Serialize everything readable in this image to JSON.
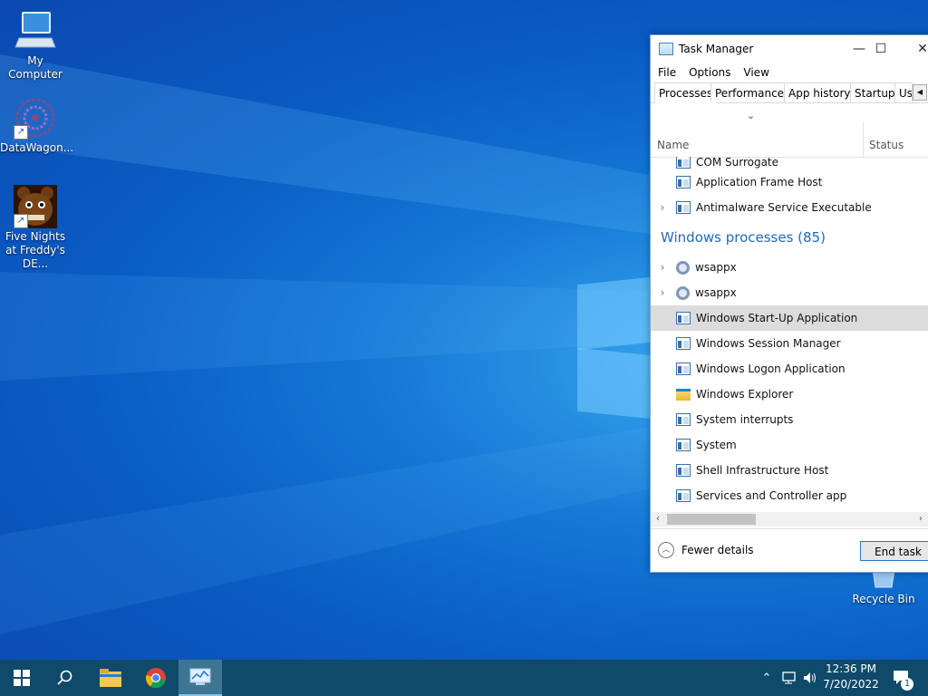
{
  "desktop": {
    "icons": [
      {
        "label": "My Computer",
        "icon": "computer-icon"
      },
      {
        "label": "DataWagon...",
        "icon": "datawagon-icon"
      },
      {
        "label": "Five Nights at Freddy's DE...",
        "icon": "freddy-icon"
      },
      {
        "label": "Recycle Bin",
        "icon": "recycle-bin-icon"
      }
    ]
  },
  "task_manager": {
    "title": "Task Manager",
    "title_buttons": {
      "minimize": "—",
      "maximize": "☐",
      "close": "✕"
    },
    "menu": [
      "File",
      "Options",
      "View"
    ],
    "tabs": [
      {
        "label": "Processes",
        "active": true
      },
      {
        "label": "Performance"
      },
      {
        "label": "App history"
      },
      {
        "label": "Startup"
      },
      {
        "label": "Us"
      }
    ],
    "columns": {
      "sort_indicator": "⌄",
      "name": "Name",
      "status": "Status"
    },
    "group_header": "Windows processes (85)",
    "rows_above": [
      {
        "name": "COM Surrogate",
        "icon": "win",
        "expandable": false
      },
      {
        "name": "Application Frame Host",
        "icon": "win",
        "expandable": false
      },
      {
        "name": "Antimalware Service Executable",
        "icon": "win",
        "expandable": true
      }
    ],
    "rows": [
      {
        "name": "wsappx",
        "icon": "gear",
        "expandable": true
      },
      {
        "name": "wsappx",
        "icon": "gear",
        "expandable": true
      },
      {
        "name": "Windows Start-Up Application",
        "icon": "win",
        "expandable": false,
        "selected": true
      },
      {
        "name": "Windows Session Manager",
        "icon": "win",
        "expandable": false
      },
      {
        "name": "Windows Logon Application",
        "icon": "win",
        "expandable": false
      },
      {
        "name": "Windows Explorer",
        "icon": "folder",
        "expandable": false
      },
      {
        "name": "System interrupts",
        "icon": "win",
        "expandable": false
      },
      {
        "name": "System",
        "icon": "win",
        "expandable": false
      },
      {
        "name": "Shell Infrastructure Host",
        "icon": "win",
        "expandable": false
      },
      {
        "name": "Services and Controller app",
        "icon": "win",
        "expandable": false
      }
    ],
    "footer": {
      "fewer_details": "Fewer details",
      "end_task": "End task"
    }
  },
  "taskbar": {
    "items": [
      "start-icon",
      "search-icon",
      "file-explorer-icon",
      "chrome-icon",
      "task-manager-icon"
    ],
    "tray": {
      "chevron": "⌃",
      "notification_count": "1"
    },
    "time": "12:36 PM",
    "date": "7/20/2022"
  }
}
